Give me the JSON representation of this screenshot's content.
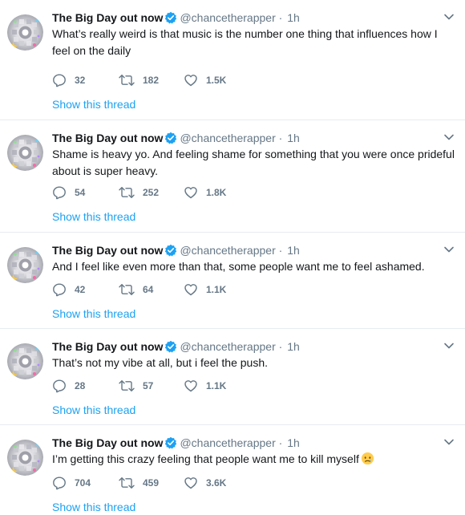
{
  "tweets": [
    {
      "name": "The Big Day out now",
      "handle": "@chancetherapper",
      "dot": "·",
      "time": "1h",
      "text": "What’s really weird is that music is the number one thing that influences how I feel on the daily",
      "replies": "32",
      "retweets": "182",
      "likes": "1.5K",
      "thread_link": "Show this thread"
    },
    {
      "name": "The Big Day out now",
      "handle": "@chancetherapper",
      "dot": "·",
      "time": "1h",
      "text": "Shame is heavy yo. And feeling shame for something that you were once prideful about is super heavy.",
      "replies": "54",
      "retweets": "252",
      "likes": "1.8K",
      "thread_link": "Show this thread"
    },
    {
      "name": "The Big Day out now",
      "handle": "@chancetherapper",
      "dot": "·",
      "time": "1h",
      "text": "And I feel like even more than that, some people want me to feel ashamed.",
      "replies": "42",
      "retweets": "64",
      "likes": "1.1K",
      "thread_link": "Show this thread"
    },
    {
      "name": "The Big Day out now",
      "handle": "@chancetherapper",
      "dot": "·",
      "time": "1h",
      "text": "That’s not my vibe at all, but i feel the push.",
      "replies": "28",
      "retweets": "57",
      "likes": "1.1K",
      "thread_link": "Show this thread"
    },
    {
      "name": "The Big Day out now",
      "handle": "@chancetherapper",
      "dot": "·",
      "time": "1h",
      "text": "I’m getting this crazy feeling that people want me to kill myself",
      "has_emoji": "crying-face-emoji",
      "replies": "704",
      "retweets": "459",
      "likes": "3.6K",
      "thread_link": "Show this thread"
    }
  ],
  "colors": {
    "accent": "#1da1f2",
    "secondary_text": "#657786",
    "border": "#e6ecf0",
    "verified": "#1da1f2"
  },
  "icons": {
    "reply": "reply-icon",
    "retweet": "retweet-icon",
    "like": "heart-icon",
    "verified": "verified-badge-icon",
    "caret": "chevron-down-icon"
  }
}
